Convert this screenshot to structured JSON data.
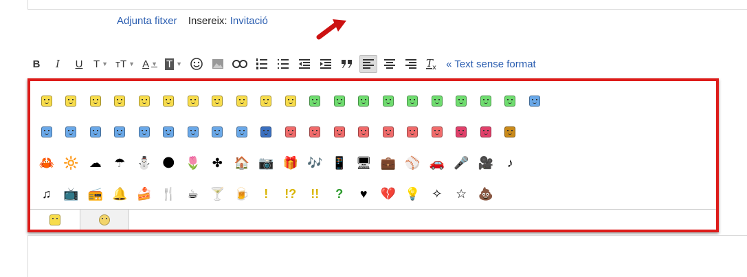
{
  "attach": {
    "attach_label": "Adjunta fitxer",
    "insert_label": "Insereix:",
    "invitation_label": "Invitació"
  },
  "toolbar": {
    "items": [
      {
        "label": "B"
      },
      {
        "label": "I"
      },
      {
        "label": "U"
      },
      {
        "label": "T"
      },
      {
        "label": "тT"
      },
      {
        "label": "A"
      },
      {
        "label": "T"
      }
    ],
    "plain_text_label": "« Text sense format"
  },
  "emoji_rows": [
    [
      "#f7dc4c",
      "#f7dc4c",
      "#f7dc4c",
      "#f7dc4c",
      "#f7dc4c",
      "#f7dc4c",
      "#f7dc4c",
      "#f7dc4c",
      "#f7dc4c",
      "#f7dc4c",
      "#f7dc4c",
      "#6fdc6f",
      "#6fdc6f",
      "#6fdc6f",
      "#6fdc6f",
      "#6fdc6f",
      "#6fdc6f",
      "#6fdc6f",
      "#6fdc6f",
      "#6fdc6f",
      "#6aa8e8"
    ],
    [
      "#6aa8e8",
      "#6aa8e8",
      "#6aa8e8",
      "#6aa8e8",
      "#6aa8e8",
      "#6aa8e8",
      "#6aa8e8",
      "#6aa8e8",
      "#6aa8e8",
      "#3a6fbf",
      "#f06b6b",
      "#f06b6b",
      "#f06b6b",
      "#f06b6b",
      "#f06b6b",
      "#f06b6b",
      "#f06b6b",
      "#e0406a",
      "#e0406a",
      "#c98a1a"
    ],
    [
      "🦀",
      "🔆",
      "☁",
      "☂",
      "⛄",
      "🌑",
      "🌷",
      "✤",
      "🏠",
      "📷",
      "🎁",
      "🎶",
      "📱",
      "🖥",
      "💼",
      "⚾",
      "🚗",
      "🎤",
      "🎥",
      "♪"
    ],
    [
      "♫",
      "📺",
      "📻",
      "🔔",
      "🍰",
      "🍴",
      "☕",
      "🍸",
      "🍺",
      "!",
      "!?",
      "!!",
      "?",
      "♥",
      "💔",
      "💡",
      "✧",
      "☆",
      "💩"
    ]
  ],
  "colors": {
    "accent": "#dd1c1a",
    "link": "#2a5db0"
  }
}
